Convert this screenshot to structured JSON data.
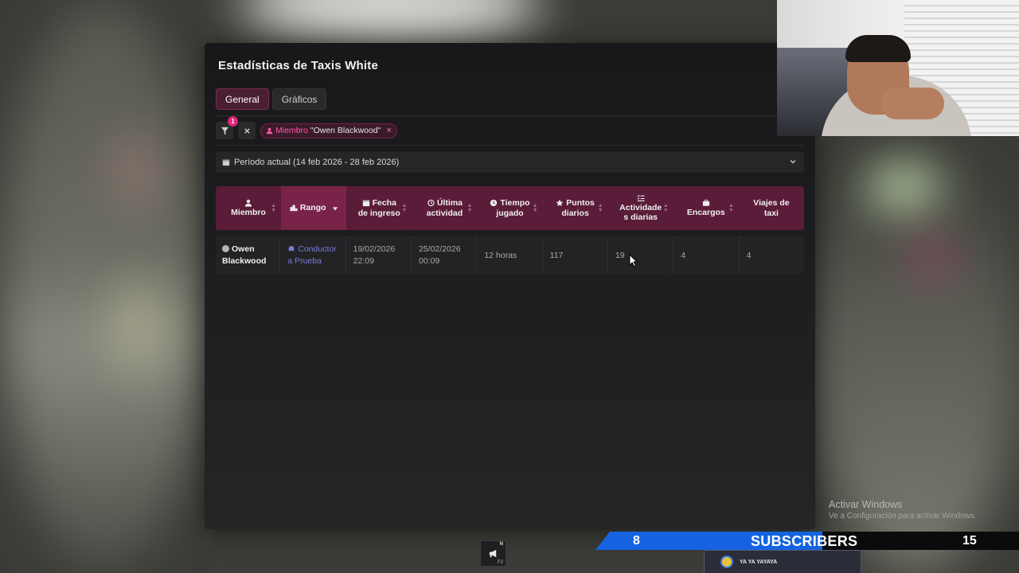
{
  "panel": {
    "title": "Estadísticas de Taxis White",
    "tabs": [
      {
        "label": "General",
        "active": true
      },
      {
        "label": "Gráficos",
        "active": false
      }
    ],
    "filter": {
      "badge_count": "1",
      "clear_icon": "close-icon",
      "chip_key": "Miembro",
      "chip_value": "\"Owen Blackwood\"",
      "chip_remove": "×"
    },
    "period": {
      "label": "Período actual (14 feb 2026 - 28 feb 2026)"
    },
    "table": {
      "columns": [
        {
          "icon": "user-icon",
          "line1": "Miembro",
          "line2": ""
        },
        {
          "icon": "rank-icon",
          "line1": "Rango",
          "line2": ""
        },
        {
          "icon": "calendar-icon",
          "line1": "Fecha",
          "line2": "de ingreso"
        },
        {
          "icon": "history-icon",
          "line1": "Última",
          "line2": "actividad"
        },
        {
          "icon": "clock-icon",
          "line1": "Tiempo",
          "line2": "jugado"
        },
        {
          "icon": "star-icon",
          "line1": "Puntos",
          "line2": "diarios"
        },
        {
          "icon": "list-check-icon",
          "line1": "Actividade",
          "line2": "s diarias"
        },
        {
          "icon": "briefcase-icon",
          "line1": "Encargos",
          "line2": ""
        },
        {
          "icon": "",
          "line1": "Viajes de",
          "line2": "taxi"
        }
      ],
      "rows": [
        {
          "member_line1": "Owen",
          "member_line2": "Blackwood",
          "rank_line1": "Conductor",
          "rank_line2": "a Prueba",
          "joined_date": "19/02/2026",
          "joined_time": "22:09",
          "last_date": "25/02/2026",
          "last_time": "00:09",
          "time_played": "12 horas",
          "daily_points": "117",
          "daily_activities": "19",
          "assignments": "4",
          "taxi_trips": "4"
        }
      ]
    }
  },
  "overlay": {
    "activate_title": "Activar Windows",
    "activate_subtitle": "Ve a Configuración para activar Windows.",
    "hud_key_top": "N",
    "hud_key_bottom": "F2",
    "subs_left": "8",
    "subs_label": "SUBSCRIBERS",
    "subs_right": "15",
    "notif_text": "YA YA YAYAYA"
  },
  "colors": {
    "accent": "#e0247a",
    "header_bg": "#5a1c39",
    "header_active": "#7a2349",
    "rank_link": "#7a7ae0"
  }
}
